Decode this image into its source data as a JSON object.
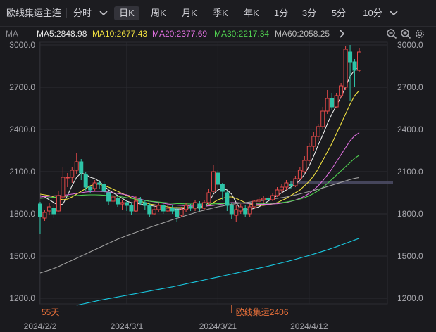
{
  "toolbar": {
    "contract": "欧线集运主连",
    "periods": [
      "分时",
      "日K",
      "周K",
      "月K",
      "季K",
      "年K",
      "1分",
      "3分",
      "5分",
      "10分"
    ],
    "active_period": "日K"
  },
  "ma_bar": {
    "label": "MA",
    "items": [
      {
        "text": "MA5:2848.98",
        "color": "#e8e8e8"
      },
      {
        "text": "MA10:2677.43",
        "color": "#f0e040"
      },
      {
        "text": "MA20:2377.69",
        "color": "#e070e0"
      },
      {
        "text": "MA30:2217.34",
        "color": "#50d050"
      },
      {
        "text": "MA60:2058.25",
        "color": "#b8b8b8"
      }
    ]
  },
  "colors": {
    "up": "#e84a4a",
    "down": "#2ec4a8",
    "ma5": "#e8e8e8",
    "ma10": "#f0e040",
    "ma20": "#e070e0",
    "ma30": "#50d050",
    "ma60": "#a0a0a0",
    "long_ma": "#18c8e0",
    "grid": "#2c2c32",
    "axis_text": "#a8a8ae",
    "bottom_label": "#e8703a"
  },
  "chart_data": {
    "type": "candlestick",
    "ylim": [
      1100,
      3020
    ],
    "y_ticks": [
      3000,
      2700,
      2400,
      2100,
      1800,
      1500,
      1200
    ],
    "y_tick_labels": [
      "3000.0",
      "2700.0",
      "2400.0",
      "2100.0",
      "1800.0",
      "1500.0",
      "1200.0"
    ],
    "x_tick_labels": [
      {
        "index": 0,
        "label": "2024/2/2"
      },
      {
        "index": 19,
        "label": "2024/3/1"
      },
      {
        "index": 39,
        "label": "2024/3/21"
      },
      {
        "index": 59,
        "label": "2024/4/12"
      }
    ],
    "bottom_left_label": "55天",
    "bottom_mid_label": "欧线集运2406",
    "bottom_mid_index": 42,
    "reference_price": 2020,
    "reference_start_index": 55,
    "candles": [
      [
        1870,
        1780,
        1885,
        1660
      ],
      [
        1770,
        1810,
        1830,
        1750
      ],
      [
        1820,
        1850,
        1880,
        1790
      ],
      [
        1840,
        1800,
        1860,
        1770
      ],
      [
        1820,
        1930,
        1960,
        1810
      ],
      [
        1920,
        2060,
        2130,
        1900
      ],
      [
        2060,
        2060,
        2090,
        1990
      ],
      [
        2060,
        2110,
        2130,
        2020
      ],
      [
        2110,
        2170,
        2230,
        2080
      ],
      [
        2170,
        2090,
        2190,
        2040
      ],
      [
        2080,
        1990,
        2100,
        1960
      ],
      [
        1990,
        1970,
        2000,
        1950
      ],
      [
        1980,
        2020,
        2040,
        1960
      ],
      [
        2020,
        2010,
        2040,
        1980
      ],
      [
        2010,
        1960,
        2030,
        1930
      ],
      [
        1950,
        1890,
        1960,
        1860
      ],
      [
        1890,
        1920,
        1960,
        1880
      ],
      [
        1910,
        1870,
        1930,
        1850
      ],
      [
        1870,
        1880,
        1900,
        1830
      ],
      [
        1880,
        1860,
        1900,
        1820
      ],
      [
        1860,
        1820,
        1880,
        1790
      ],
      [
        1820,
        1890,
        1930,
        1810
      ],
      [
        1900,
        1880,
        1920,
        1860
      ],
      [
        1880,
        1860,
        1900,
        1830
      ],
      [
        1860,
        1800,
        1880,
        1780
      ],
      [
        1800,
        1830,
        1860,
        1790
      ],
      [
        1830,
        1860,
        1880,
        1810
      ],
      [
        1860,
        1820,
        1880,
        1800
      ],
      [
        1820,
        1840,
        1870,
        1810
      ],
      [
        1840,
        1820,
        1860,
        1800
      ],
      [
        1830,
        1780,
        1850,
        1740
      ],
      [
        1790,
        1830,
        1850,
        1780
      ],
      [
        1830,
        1860,
        1880,
        1810
      ],
      [
        1850,
        1840,
        1870,
        1820
      ],
      [
        1840,
        1880,
        1900,
        1820
      ],
      [
        1870,
        1840,
        1890,
        1820
      ],
      [
        1840,
        1880,
        1900,
        1830
      ],
      [
        1880,
        1950,
        1980,
        1860
      ],
      [
        1960,
        2100,
        2150,
        1950
      ],
      [
        2090,
        2010,
        2110,
        1970
      ],
      [
        2010,
        1960,
        2020,
        1900
      ],
      [
        1950,
        1860,
        1960,
        1820
      ],
      [
        1860,
        1800,
        1880,
        1760
      ],
      [
        1790,
        1830,
        1860,
        1740
      ],
      [
        1820,
        1850,
        1870,
        1800
      ],
      [
        1840,
        1800,
        1860,
        1780
      ],
      [
        1800,
        1850,
        1870,
        1780
      ],
      [
        1850,
        1890,
        1900,
        1840
      ],
      [
        1890,
        1900,
        1920,
        1860
      ],
      [
        1900,
        1910,
        1930,
        1880
      ],
      [
        1910,
        1900,
        1930,
        1880
      ],
      [
        1900,
        1930,
        1950,
        1890
      ],
      [
        1930,
        1970,
        1990,
        1920
      ],
      [
        1970,
        1990,
        2010,
        1950
      ],
      [
        1990,
        2020,
        2040,
        1970
      ],
      [
        2010,
        2000,
        2030,
        1980
      ],
      [
        2000,
        2050,
        2070,
        1990
      ],
      [
        2050,
        2110,
        2130,
        2040
      ],
      [
        2100,
        2180,
        2210,
        2090
      ],
      [
        2180,
        2280,
        2300,
        2160
      ],
      [
        2280,
        2350,
        2380,
        2250
      ],
      [
        2350,
        2420,
        2440,
        2320
      ],
      [
        2420,
        2530,
        2560,
        2400
      ],
      [
        2530,
        2620,
        2680,
        2510
      ],
      [
        2620,
        2560,
        2660,
        2540
      ],
      [
        2560,
        2640,
        2660,
        2550
      ],
      [
        2640,
        2710,
        2730,
        2620
      ],
      [
        2700,
        2970,
        2990,
        2680
      ],
      [
        2950,
        2880,
        3000,
        2600
      ],
      [
        2880,
        2820,
        2900,
        2700
      ],
      [
        2820,
        2950,
        2980,
        2810
      ]
    ],
    "moving_averages": [
      {
        "key": "ma5",
        "values": [
          1930,
          1920,
          1900,
          1880,
          1860,
          1870,
          1930,
          2000,
          2060,
          2090,
          2080,
          2060,
          2050,
          2030,
          2000,
          1970,
          1950,
          1930,
          1910,
          1890,
          1880,
          1875,
          1870,
          1865,
          1860,
          1855,
          1850,
          1845,
          1840,
          1835,
          1835,
          1835,
          1840,
          1840,
          1845,
          1850,
          1855,
          1880,
          1940,
          1970,
          1980,
          1970,
          1940,
          1880,
          1830,
          1830,
          1830,
          1840,
          1850,
          1870,
          1890,
          1910,
          1930,
          1950,
          1970,
          1990,
          2010,
          2040,
          2080,
          2140,
          2210,
          2290,
          2360,
          2440,
          2510,
          2570,
          2630,
          2700,
          2780,
          2820,
          2849
        ]
      },
      {
        "key": "ma10",
        "values": [
          1940,
          1935,
          1930,
          1920,
          1910,
          1900,
          1905,
          1920,
          1940,
          1960,
          1980,
          2000,
          2010,
          2010,
          2000,
          1990,
          1975,
          1960,
          1945,
          1930,
          1915,
          1900,
          1890,
          1880,
          1870,
          1865,
          1860,
          1855,
          1850,
          1845,
          1845,
          1845,
          1845,
          1845,
          1845,
          1845,
          1850,
          1860,
          1880,
          1900,
          1910,
          1920,
          1920,
          1910,
          1895,
          1880,
          1870,
          1860,
          1860,
          1860,
          1865,
          1870,
          1880,
          1895,
          1910,
          1930,
          1950,
          1970,
          2000,
          2030,
          2070,
          2120,
          2180,
          2240,
          2300,
          2370,
          2440,
          2510,
          2580,
          2640,
          2677
        ]
      },
      {
        "key": "ma20",
        "values": [
          1920,
          1922,
          1925,
          1928,
          1930,
          1932,
          1935,
          1940,
          1945,
          1950,
          1955,
          1958,
          1960,
          1960,
          1958,
          1955,
          1950,
          1945,
          1940,
          1935,
          1925,
          1915,
          1905,
          1895,
          1890,
          1885,
          1880,
          1875,
          1870,
          1865,
          1862,
          1860,
          1858,
          1856,
          1855,
          1855,
          1855,
          1857,
          1860,
          1865,
          1870,
          1875,
          1880,
          1880,
          1878,
          1875,
          1872,
          1870,
          1868,
          1868,
          1868,
          1870,
          1872,
          1876,
          1880,
          1888,
          1898,
          1910,
          1925,
          1945,
          1970,
          2000,
          2035,
          2075,
          2120,
          2170,
          2220,
          2270,
          2320,
          2355,
          2377
        ]
      },
      {
        "key": "ma30",
        "values": [
          1910,
          1912,
          1915,
          1918,
          1920,
          1922,
          1925,
          1928,
          1930,
          1932,
          1934,
          1935,
          1935,
          1934,
          1932,
          1930,
          1928,
          1925,
          1920,
          1915,
          1910,
          1905,
          1900,
          1895,
          1890,
          1887,
          1884,
          1881,
          1878,
          1875,
          1873,
          1872,
          1871,
          1870,
          1870,
          1870,
          1870,
          1870,
          1871,
          1872,
          1873,
          1875,
          1877,
          1878,
          1878,
          1877,
          1876,
          1875,
          1874,
          1874,
          1875,
          1876,
          1878,
          1880,
          1884,
          1890,
          1897,
          1905,
          1915,
          1928,
          1945,
          1965,
          1988,
          2015,
          2045,
          2075,
          2105,
          2135,
          2165,
          2195,
          2217
        ]
      },
      {
        "key": "ma60",
        "values": [
          1380,
          1390,
          1400,
          1412,
          1425,
          1440,
          1455,
          1470,
          1485,
          1500,
          1515,
          1530,
          1545,
          1560,
          1575,
          1590,
          1605,
          1620,
          1632,
          1645,
          1657,
          1668,
          1680,
          1692,
          1703,
          1714,
          1725,
          1736,
          1747,
          1758,
          1768,
          1778,
          1788,
          1798,
          1808,
          1818,
          1826,
          1834,
          1842,
          1850,
          1856,
          1862,
          1868,
          1872,
          1876,
          1880,
          1884,
          1888,
          1892,
          1896,
          1900,
          1905,
          1910,
          1915,
          1920,
          1927,
          1934,
          1942,
          1950,
          1958,
          1966,
          1975,
          1984,
          1994,
          2004,
          2014,
          2024,
          2034,
          2044,
          2052,
          2058
        ]
      },
      {
        "key": "long_ma",
        "values": [
          null,
          null,
          null,
          null,
          null,
          null,
          null,
          null,
          1150,
          1157,
          1164,
          1171,
          1178,
          1185,
          1191,
          1197,
          1203,
          1209,
          1215,
          1221,
          1227,
          1233,
          1239,
          1245,
          1251,
          1257,
          1263,
          1269,
          1275,
          1281,
          1288,
          1295,
          1302,
          1309,
          1316,
          1323,
          1330,
          1337,
          1344,
          1351,
          1358,
          1365,
          1372,
          1379,
          1386,
          1393,
          1400,
          1407,
          1414,
          1421,
          1428,
          1436,
          1444,
          1452,
          1460,
          1468,
          1477,
          1486,
          1495,
          1504,
          1514,
          1524,
          1534,
          1544,
          1555,
          1566,
          1578,
          1590,
          1602,
          1614,
          1626
        ]
      }
    ]
  }
}
